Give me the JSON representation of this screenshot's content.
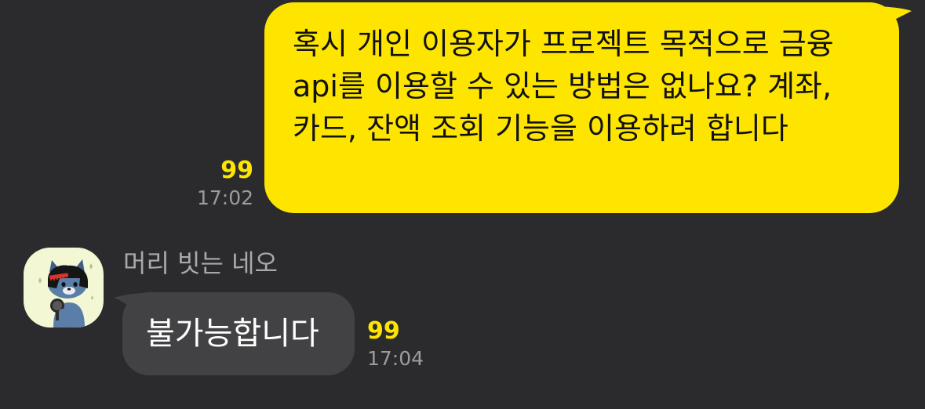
{
  "theme": {
    "background": "#2b2b2d",
    "outgoing_bubble": "#fee500",
    "incoming_bubble": "#424244",
    "unread_color": "#fee500",
    "meta_text": "#9c9c9e"
  },
  "messages": [
    {
      "direction": "outgoing",
      "text": "혹시 개인 이용자가 프로젝트 목적으로 금융 api를 이용할 수 있는 방법은 없나요? 계좌, 카드, 잔액 조회 기능을 이용하려 합니다",
      "unread_count": "99",
      "time": "17:02"
    },
    {
      "direction": "incoming",
      "sender": "머리 빗는 네오",
      "avatar_icon": "neo-character-avatar-icon",
      "text": "불가능합니다",
      "unread_count": "99",
      "time": "17:04"
    }
  ]
}
